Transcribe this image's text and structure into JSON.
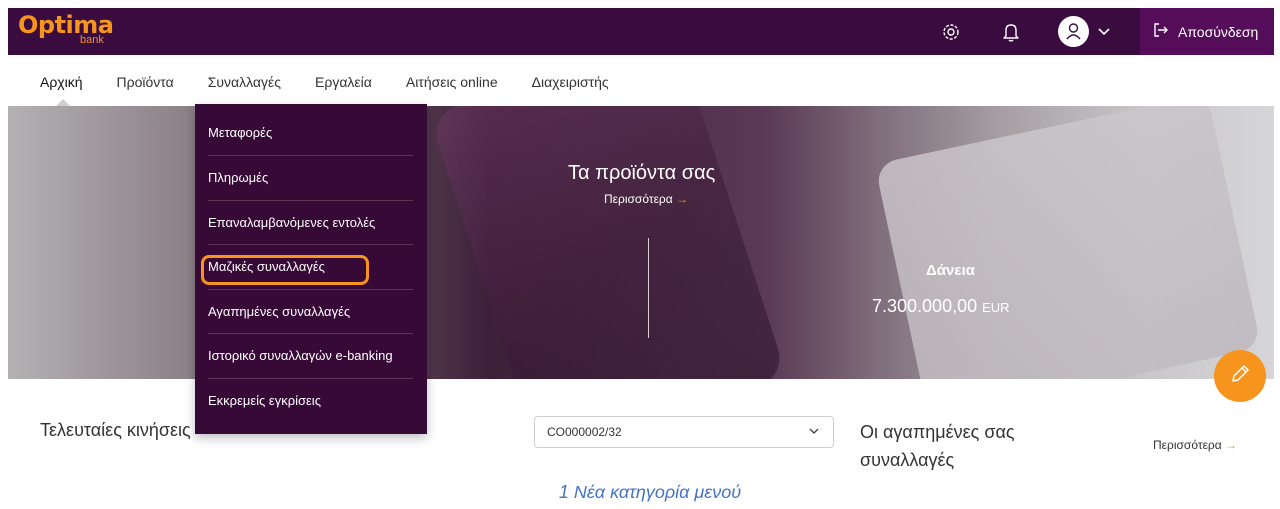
{
  "brand": {
    "logo": "Optima",
    "logo_sub": "bank",
    "color": "#f7941d",
    "topbar_color": "#3a0b3e"
  },
  "topbar": {
    "settings_icon": "gear-icon",
    "notifications_icon": "bell-icon",
    "user_icon": "user-avatar-icon",
    "logout_label": "Αποσύνδεση"
  },
  "nav": {
    "items": [
      "Αρχική",
      "Προϊόντα",
      "Συναλλαγές",
      "Εργαλεία",
      "Αιτήσεις online",
      "Διαχειριστής"
    ]
  },
  "dropdown": {
    "items": [
      "Μεταφορές",
      "Πληρωμές",
      "Επαναλαμβανόμενες εντολές",
      "Μαζικές συναλλαγές",
      "Αγαπημένες συναλλαγές",
      "Ιστορικό συναλλαγών e-banking",
      "Εκκρεμείς εγκρίσεις"
    ],
    "highlight_color": "#f7941d"
  },
  "hero": {
    "title": "Τα προϊόντα σας",
    "more": "Περισσότερα",
    "loans_label": "Δάνεια",
    "loans_value": "7.300.000,00",
    "loans_currency": "EUR"
  },
  "recent": {
    "title": "Τελευταίες κινήσεις",
    "account": "CO000002/32"
  },
  "favorites": {
    "title": "Οι αγαπημένες σας συναλλαγές",
    "more": "Περισσότερα"
  },
  "caption": "1 Νέα κατηγορία μενού"
}
